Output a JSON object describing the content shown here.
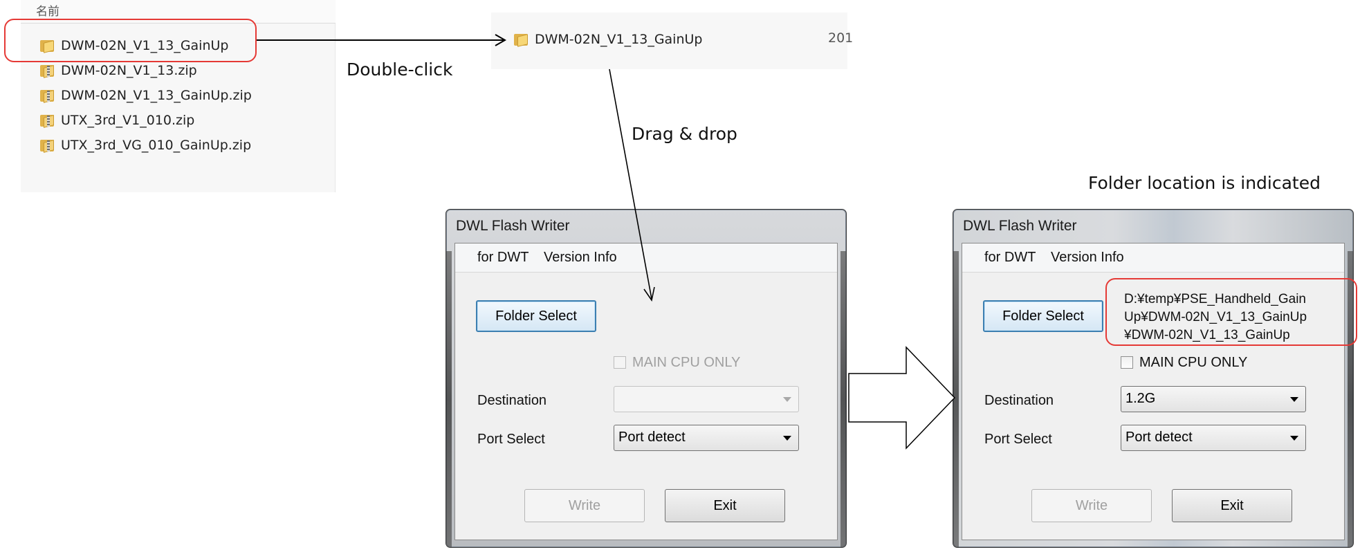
{
  "explorer": {
    "column_header": "名前",
    "items": [
      {
        "name": "DWM-02N_V1_13_GainUp",
        "type": "folder"
      },
      {
        "name": "DWM-02N_V1_13.zip",
        "type": "zip"
      },
      {
        "name": "DWM-02N_V1_13_GainUp.zip",
        "type": "zip"
      },
      {
        "name": "UTX_3rd_V1_010.zip",
        "type": "zip"
      },
      {
        "name": "UTX_3rd_VG_010_GainUp.zip",
        "type": "zip"
      }
    ]
  },
  "strip": {
    "folder_name": "DWM-02N_V1_13_GainUp",
    "date_fragment": "201"
  },
  "annotations": {
    "double_click": "Double-click",
    "drag_drop": "Drag & drop",
    "folder_location": "Folder location is indicated"
  },
  "window_before": {
    "title": "DWL Flash Writer",
    "menu": [
      "for DWT",
      "Version Info"
    ],
    "folder_select_label": "Folder Select",
    "main_cpu_only_label": "MAIN CPU ONLY",
    "destination_label": "Destination",
    "destination_value": "",
    "port_select_label": "Port Select",
    "port_select_value": "Port detect",
    "write_label": "Write",
    "exit_label": "Exit"
  },
  "window_after": {
    "title": "DWL Flash Writer",
    "menu": [
      "for DWT",
      "Version Info"
    ],
    "folder_select_label": "Folder Select",
    "folder_path_lines": [
      "D:¥temp¥PSE_Handheld_Gain",
      "Up¥DWM-02N_V1_13_GainUp",
      "¥DWM-02N_V1_13_GainUp"
    ],
    "main_cpu_only_label": "MAIN CPU ONLY",
    "destination_label": "Destination",
    "destination_value": "1.2G",
    "port_select_label": "Port Select",
    "port_select_value": "Port detect",
    "write_label": "Write",
    "exit_label": "Exit"
  },
  "colors": {
    "highlight": "#e53935",
    "focus_blue": "#3c7fb1",
    "folder_yellow": "#f7d777"
  }
}
